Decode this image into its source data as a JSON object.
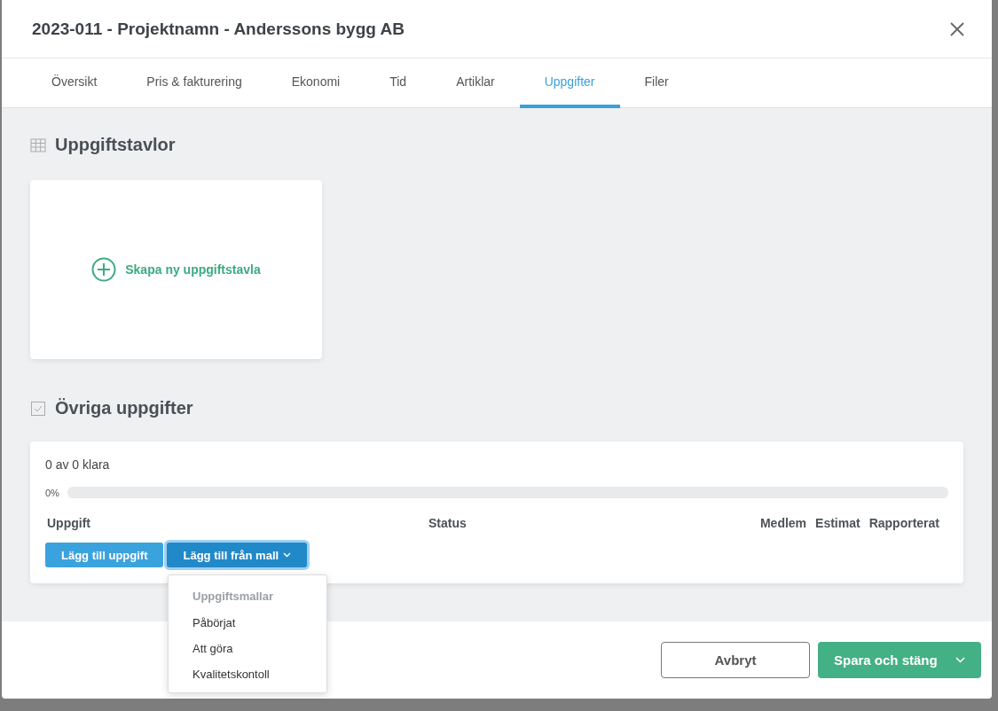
{
  "window": {
    "title": "2023-011 - Projektnamn - Anderssons bygg AB"
  },
  "tabs": [
    {
      "label": "Översikt",
      "selected": false
    },
    {
      "label": "Pris & fakturering",
      "selected": false
    },
    {
      "label": "Ekonomi",
      "selected": false
    },
    {
      "label": "Tid",
      "selected": false
    },
    {
      "label": "Artiklar",
      "selected": false
    },
    {
      "label": "Uppgifter",
      "selected": true
    },
    {
      "label": "Filer",
      "selected": false
    }
  ],
  "boards": {
    "heading": "Uppgiftstavlor",
    "create_label": "Skapa ny uppgiftstavla"
  },
  "tasks": {
    "heading": "Övriga uppgifter",
    "summary": "0 av 0 klara",
    "progress": {
      "reading": "0%",
      "level": 0
    },
    "columns": [
      "Uppgift",
      "Status",
      "Medlem",
      "Estimat",
      "Rapporterat"
    ],
    "add_button": "Lägg till uppgift",
    "template_button": "Lägg till från mall",
    "template_menu": {
      "header": "Uppgiftsmallar",
      "items": [
        "Påbörjat",
        "Att göra",
        "Kvalitetskontoll"
      ]
    }
  },
  "footer": {
    "cancel": "Avbryt",
    "save": "Spara och stäng"
  }
}
